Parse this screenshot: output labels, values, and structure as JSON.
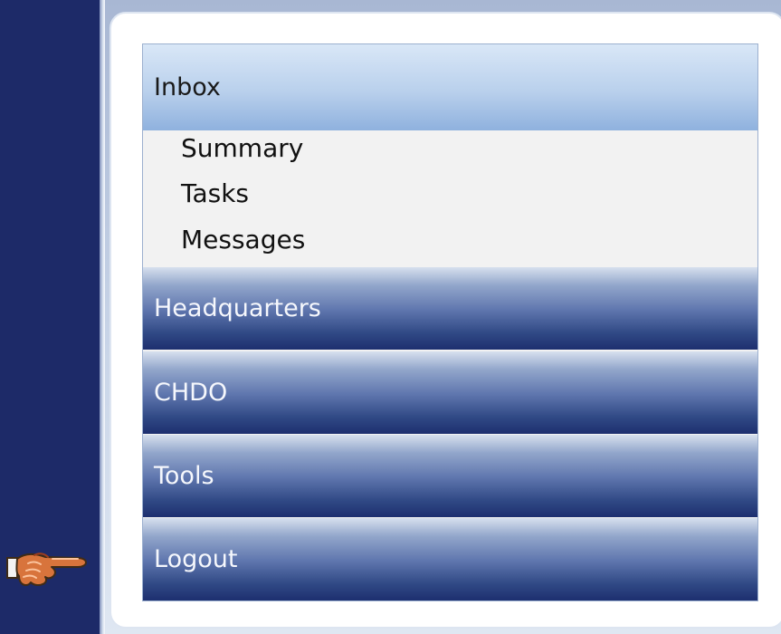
{
  "menu": {
    "inbox_label": "Inbox",
    "inbox_items": [
      "Summary",
      "Tasks",
      "Messages"
    ],
    "headquarters_label": "Headquarters",
    "chdo_label": "CHDO",
    "tools_label": "Tools",
    "logout_label": "Logout"
  },
  "icons": {
    "pointer": "pointing-hand-icon"
  },
  "colors": {
    "background": "#1d2a68",
    "dark_header": "#304985",
    "light_header": "#8fb1de",
    "submenu_background": "#f2f2f2",
    "text_dark": "#111111",
    "text_light": "#f5f7fc"
  }
}
